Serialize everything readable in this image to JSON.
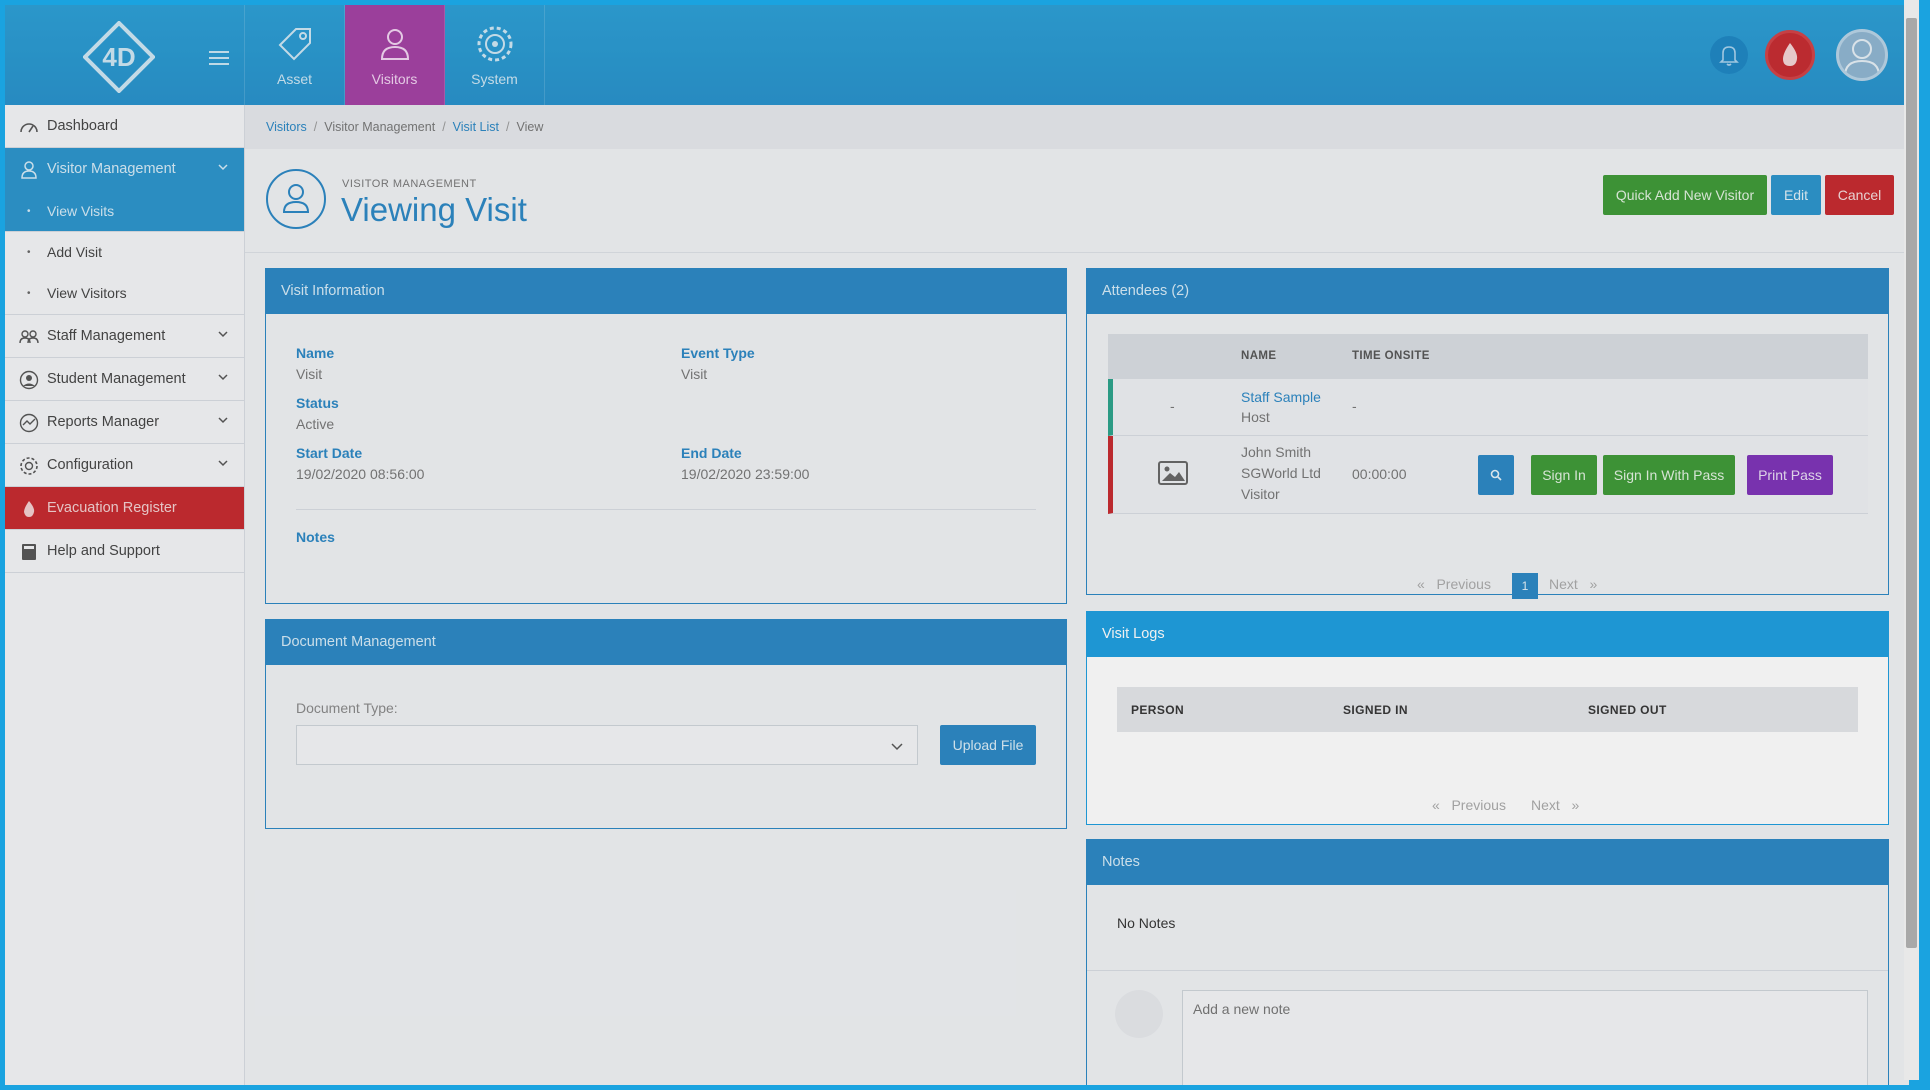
{
  "topnav": {
    "asset_label": "Asset",
    "visitors_label": "Visitors",
    "system_label": "System"
  },
  "sidebar": {
    "dashboard": "Dashboard",
    "visitor_management": "Visitor Management",
    "view_visits": "View Visits",
    "add_visit": "Add Visit",
    "view_visitors": "View Visitors",
    "staff_management": "Staff Management",
    "student_management": "Student Management",
    "reports_manager": "Reports Manager",
    "configuration": "Configuration",
    "evacuation_register": "Evacuation Register",
    "help_support": "Help and Support"
  },
  "breadcrumb": {
    "visitors": "Visitors",
    "visitor_management": "Visitor Management",
    "visit_list": "Visit List",
    "view": "View",
    "sep": "/"
  },
  "header": {
    "kicker": "VISITOR MANAGEMENT",
    "title": "Viewing Visit",
    "quick_add": "Quick Add New Visitor",
    "edit": "Edit",
    "cancel": "Cancel"
  },
  "visit_info": {
    "title": "Visit Information",
    "name_label": "Name",
    "name_value": "Visit",
    "event_type_label": "Event Type",
    "event_type_value": "Visit",
    "status_label": "Status",
    "status_value": "Active",
    "start_date_label": "Start Date",
    "start_date_value": "19/02/2020 08:56:00",
    "end_date_label": "End Date",
    "end_date_value": "19/02/2020 23:59:00",
    "notes_label": "Notes"
  },
  "document_management": {
    "title": "Document Management",
    "document_type_label": "Document Type:",
    "upload_button": "Upload File"
  },
  "attendees": {
    "title": "Attendees (2)",
    "col_name": "NAME",
    "col_time_onsite": "TIME ONSITE",
    "rows": [
      {
        "photo": "-",
        "name": "Staff Sample",
        "role": "Host",
        "time_onsite": "-"
      },
      {
        "name": "John Smith",
        "company": "SGWorld Ltd",
        "role": "Visitor",
        "time_onsite": "00:00:00"
      }
    ],
    "sign_in": "Sign In",
    "sign_in_with_pass": "Sign In With Pass",
    "print_pass": "Print Pass",
    "pager": {
      "previous": "Previous",
      "next": "Next",
      "current_page": "1",
      "prev_arrow": "«",
      "next_arrow": "»"
    }
  },
  "visit_logs": {
    "title": "Visit Logs",
    "col_person": "PERSON",
    "col_signed_in": "SIGNED IN",
    "col_signed_out": "SIGNED OUT",
    "pager": {
      "previous": "Previous",
      "next": "Next",
      "prev_arrow": "«",
      "next_arrow": "»"
    }
  },
  "notes": {
    "title": "Notes",
    "empty_text": "No Notes",
    "input_placeholder": "Add a new note"
  },
  "colors": {
    "primary": "#2a87c5",
    "visitors_tab": "#a33fa3",
    "danger": "#c6282d",
    "success": "#3d9a36",
    "purple": "#7d31b8"
  }
}
